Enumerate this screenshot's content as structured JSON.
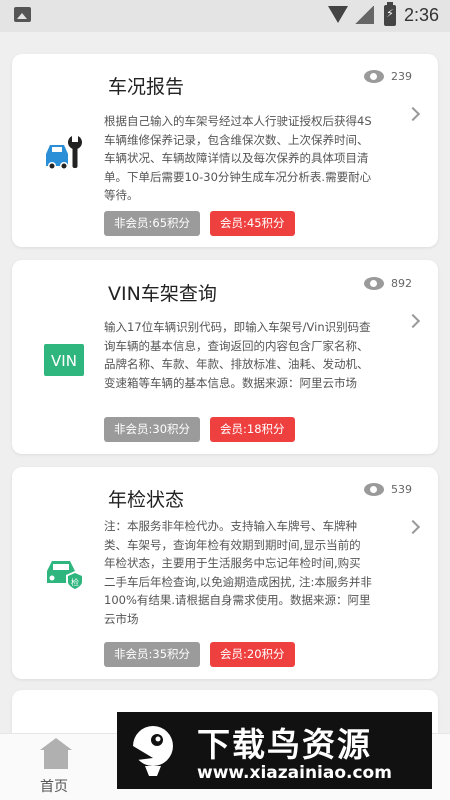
{
  "status_bar": {
    "time": "2:36"
  },
  "cards": [
    {
      "title": "车况报告",
      "views": "239",
      "desc": "根据自己输入的车架号经过本人行驶证授权后获得4S车辆维修保养记录，包含维保次数、上次保养时间、车辆状况、车辆故障详情以及每次保养的具体项目清单。下单后需要10-30分钟生成车况分析表.需要耐心等待。",
      "non_member": "非会员:65积分",
      "member": "会员:45积分",
      "icon": "car-wrench-icon"
    },
    {
      "title": "VIN车架查询",
      "views": "892",
      "desc": "输入17位车辆识别代码，即输入车架号/Vin识别码查询车辆的基本信息，查询返回的内容包含厂家名称、品牌名称、车款、年款、排放标准、油耗、发动机、变速箱等车辆的基本信息。数据来源：阿里云市场",
      "non_member": "非会员:30积分",
      "member": "会员:18积分",
      "icon": "vin-icon",
      "icon_text": "VIN"
    },
    {
      "title": "年检状态",
      "views": "539",
      "desc": "注：本服务非年检代办。支持输入车牌号、车牌种类、车架号，查询年检有效期到期时间,显示当前的年检状态，主要用于生活服务中忘记年检时间,购买二手车后年检查询,以免逾期造成困扰, 注:本服务并非100%有结果.请根据自身需求使用。数据来源：阿里云市场",
      "non_member": "非会员:35积分",
      "member": "会员:20积分",
      "icon": "car-inspection-icon",
      "icon_text": "检"
    }
  ],
  "bottom_nav": {
    "home_label": "首页"
  },
  "watermark": {
    "title": "下载鸟资源",
    "url": "www.xiazainiao.com"
  },
  "colors": {
    "badge_red": "#ef4040",
    "badge_gray": "#9b9b9b",
    "accent_blue": "#2b8fd8",
    "accent_green": "#2fb57e"
  }
}
